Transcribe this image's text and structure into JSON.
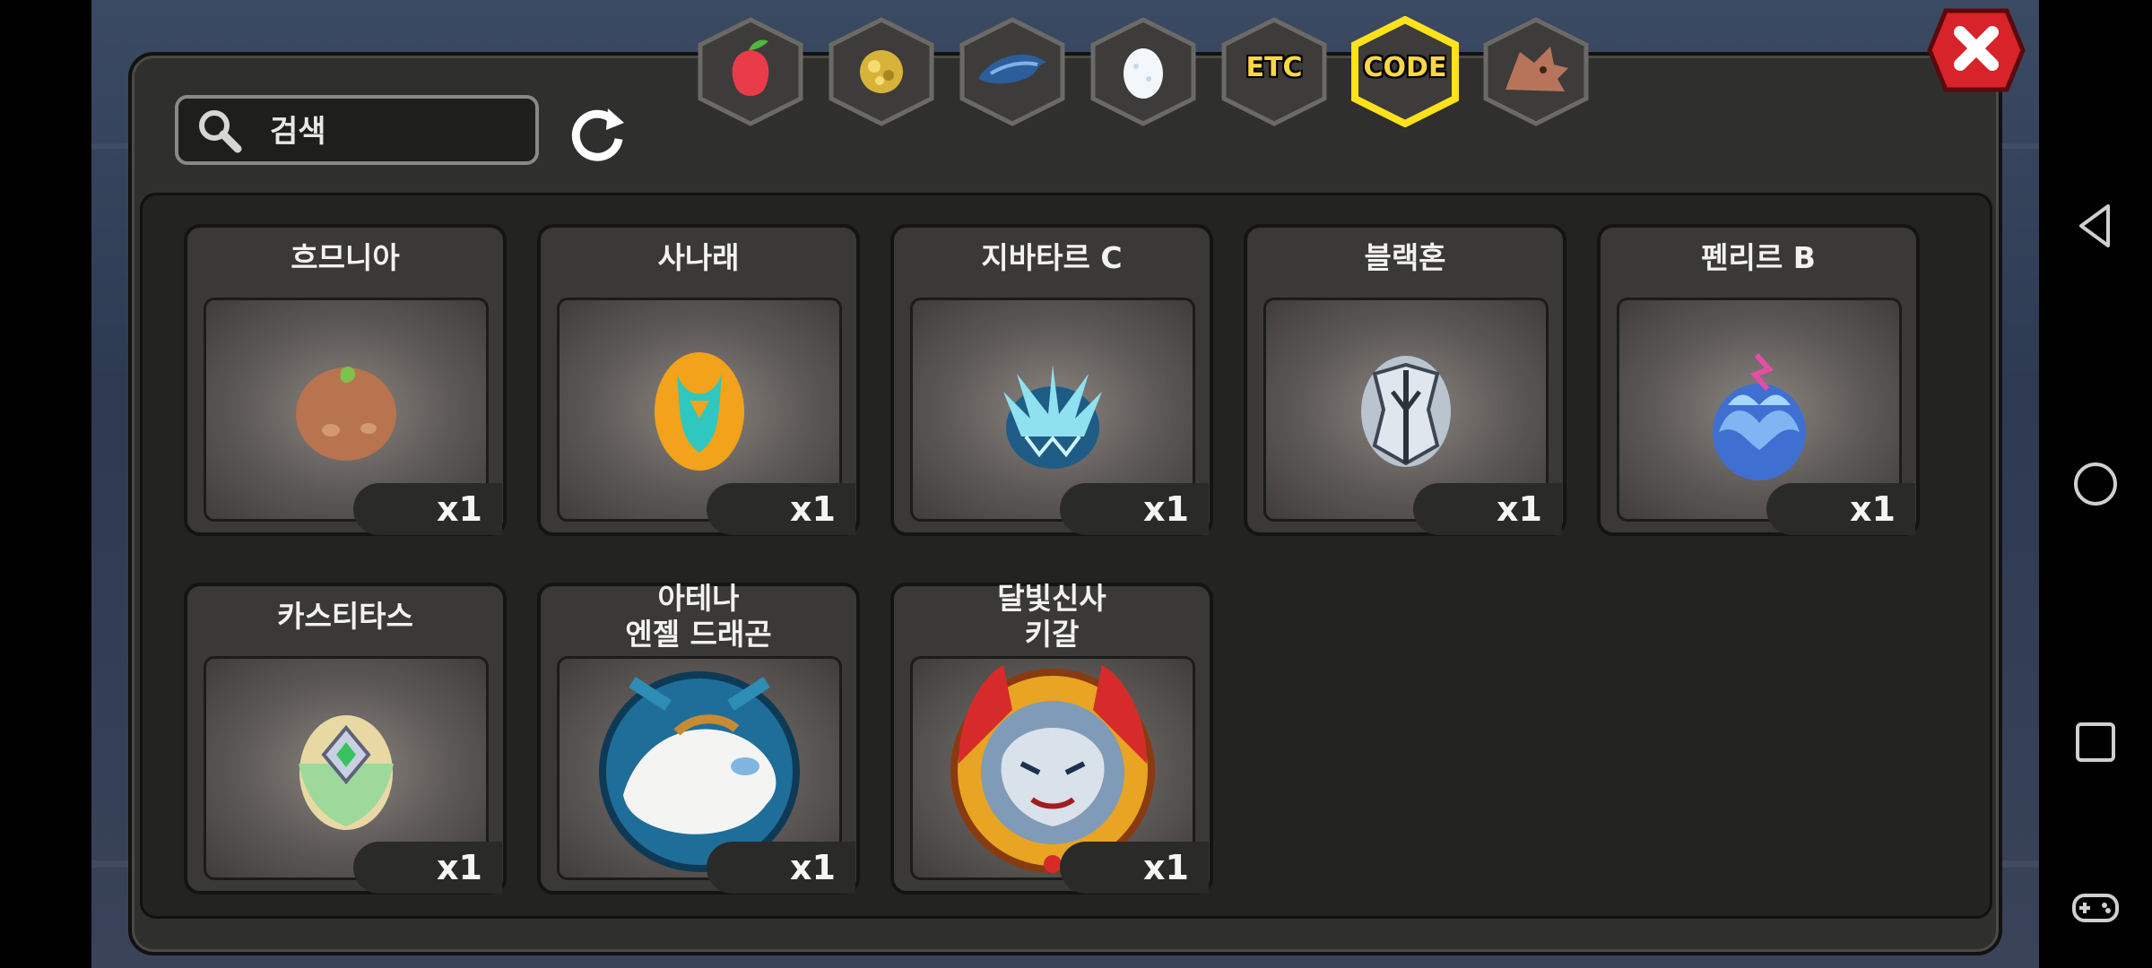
{
  "search": {
    "placeholder": "검색",
    "value": ""
  },
  "tabs": [
    {
      "label": "",
      "icon": "fruit-icon",
      "active": false
    },
    {
      "label": "",
      "icon": "gold-ore-icon",
      "active": false
    },
    {
      "label": "",
      "icon": "blue-scale-icon",
      "active": false
    },
    {
      "label": "",
      "icon": "egg-icon",
      "active": false
    },
    {
      "label": "ETC",
      "icon": "etc-text",
      "active": false
    },
    {
      "label": "CODE",
      "icon": "code-text",
      "active": true
    },
    {
      "label": "",
      "icon": "dragon-head-icon",
      "active": false
    }
  ],
  "items": [
    {
      "name": "흐므니아",
      "count": "x1",
      "icon": "brown-sprout-egg-icon"
    },
    {
      "name": "사나래",
      "count": "x1",
      "icon": "orange-teal-egg-icon"
    },
    {
      "name": "지바타르 C",
      "count": "x1",
      "icon": "lightning-crystal-egg-icon"
    },
    {
      "name": "블랙혼",
      "count": "x1",
      "icon": "silver-horn-egg-icon"
    },
    {
      "name": "펜리르 B",
      "count": "x1",
      "icon": "blue-petal-egg-icon"
    },
    {
      "name": "카스티타스",
      "count": "x1",
      "icon": "winged-crest-egg-icon"
    },
    {
      "name": "아테나\n엔젤 드래곤",
      "count": "x1",
      "icon": "white-dragon-portrait-icon"
    },
    {
      "name": "달빛신사\n키갈",
      "count": "x1",
      "icon": "silver-dragon-portrait-icon"
    }
  ],
  "colors": {
    "active_tab_border": "#ffe21a",
    "close": "#d8232a",
    "panel": "#2f2f2d"
  }
}
